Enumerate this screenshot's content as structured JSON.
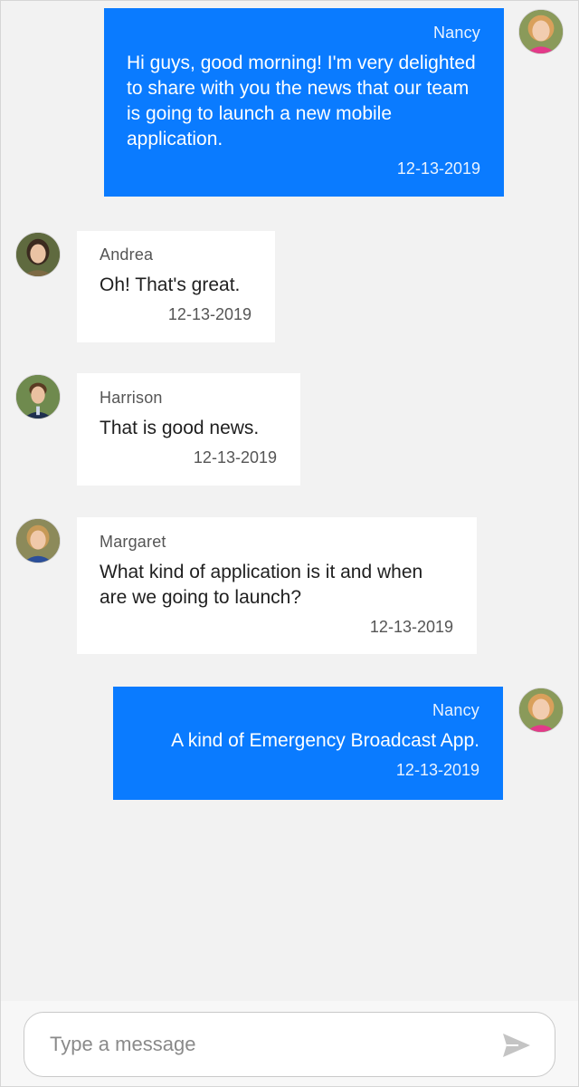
{
  "messages": [
    {
      "author": "Nancy",
      "text": "Hi guys, good morning! I'm very delighted to share with you the news that our team is going to launch a new mobile application.",
      "date": "12-13-2019",
      "direction": "outgoing"
    },
    {
      "author": "Andrea",
      "text": "Oh! That's great.",
      "date": "12-13-2019",
      "direction": "incoming"
    },
    {
      "author": "Harrison",
      "text": "That is good news.",
      "date": "12-13-2019",
      "direction": "incoming"
    },
    {
      "author": "Margaret",
      "text": "What kind of application is it and when are we going to launch?",
      "date": "12-13-2019",
      "direction": "incoming"
    },
    {
      "author": "Nancy",
      "text": "A kind of Emergency Broadcast App.",
      "date": "12-13-2019",
      "direction": "outgoing"
    }
  ],
  "composer": {
    "placeholder": "Type a message",
    "value": ""
  },
  "colors": {
    "outgoing_bubble": "#0a7bff",
    "incoming_bubble": "#ffffff",
    "background": "#f2f2f2"
  },
  "icons": {
    "send": "send-icon"
  }
}
